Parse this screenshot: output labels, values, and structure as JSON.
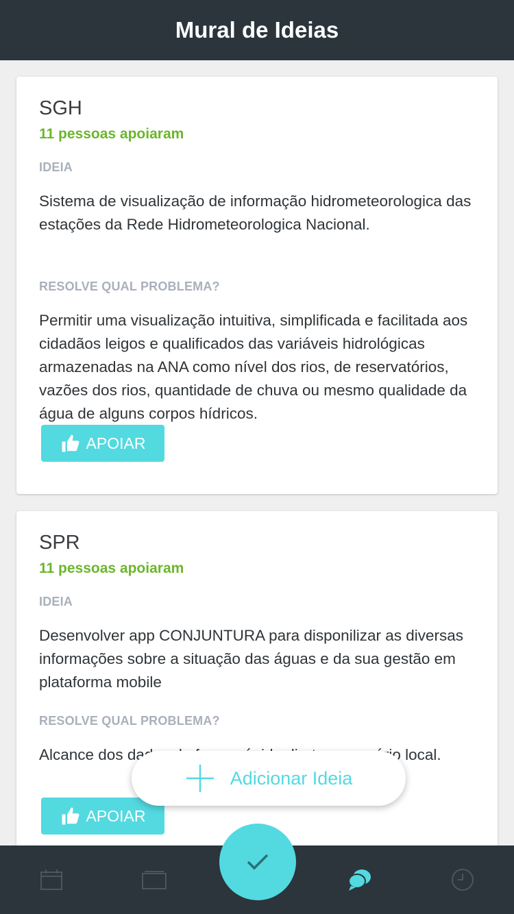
{
  "header": {
    "title": "Mural de Ideias"
  },
  "cards": [
    {
      "title": "SGH",
      "supporters": "11 pessoas apoiaram",
      "idea_label": "IDEIA",
      "idea_text": "Sistema de visualização de informação hidrometeorologica das estações da Rede Hidrometeorologica Nacional.",
      "problem_label": "RESOLVE QUAL PROBLEMA?",
      "problem_text": "Permitir uma visualização intuitiva, simplificada e facilitada aos cidadãos leigos e qualificados das variáveis hidrológicas armazenadas na ANA como nível dos rios, de reservatórios, vazões dos rios, quantidade de chuva ou mesmo qualidade da água de alguns corpos hídricos.",
      "button_label": "APOIAR"
    },
    {
      "title": "SPR",
      "supporters": "11 pessoas apoiaram",
      "idea_label": "IDEIA",
      "idea_text": "Desenvolver app CONJUNTURA para disponilizar as diversas informações sobre a situação das águas e da sua gestão em plataforma mobile",
      "problem_label": "RESOLVE QUAL PROBLEMA?",
      "problem_text": "Alcance dos dados de forma rápida direto ao usuário local.",
      "button_label": "APOIAR"
    }
  ],
  "fab": {
    "label": "Adicionar Ideia"
  },
  "tabbar": {
    "items": [
      "calendar-icon",
      "folder-icon",
      "check-icon",
      "chat-icon",
      "clock-icon"
    ],
    "active_color": "#53d9e0",
    "inactive_color": "#4b565d"
  },
  "colors": {
    "accent": "#53d9e0",
    "support": "#6cb52c",
    "header_bg": "#2b353b"
  }
}
